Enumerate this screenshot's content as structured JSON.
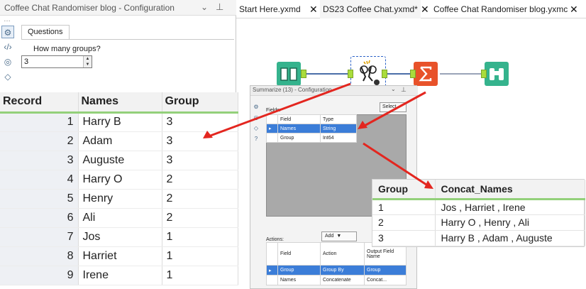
{
  "config_panel": {
    "title": "Coffee Chat Randomiser blog - Configuration",
    "tab": "Questions",
    "question": "How many groups?",
    "groups_value": "3"
  },
  "tabs": [
    {
      "label": "Start Here.yxmd"
    },
    {
      "label": "DS23 Coffee Chat.yxmd*"
    },
    {
      "label": "Coffee Chat Randomiser blog.yxmc"
    }
  ],
  "summarize": {
    "title": "Summarize (13) - Configuration",
    "fields_label": "Fields:",
    "select_label": "Select",
    "fields_header": [
      "Field",
      "Type"
    ],
    "fields": [
      {
        "field": "Names",
        "type": "String"
      },
      {
        "field": "Group",
        "type": "Int64"
      }
    ],
    "actions_label": "Actions:",
    "add_label": "Add",
    "actions_header": [
      "Field",
      "Action",
      "Output Field Name"
    ],
    "actions": [
      {
        "field": "Group",
        "action": "Group By",
        "output": "Group"
      },
      {
        "field": "Names",
        "action": "Concatenate",
        "output": "Concat..."
      }
    ]
  },
  "records": {
    "headers": [
      "Record",
      "Names",
      "Group"
    ],
    "rows": [
      {
        "record": "1",
        "name": "Harry B",
        "group": "3"
      },
      {
        "record": "2",
        "name": "Adam",
        "group": "3"
      },
      {
        "record": "3",
        "name": "Auguste",
        "group": "3"
      },
      {
        "record": "4",
        "name": "Harry O",
        "group": "2"
      },
      {
        "record": "5",
        "name": "Henry",
        "group": "2"
      },
      {
        "record": "6",
        "name": "Ali",
        "group": "2"
      },
      {
        "record": "7",
        "name": "Jos",
        "group": "1"
      },
      {
        "record": "8",
        "name": "Harriet",
        "group": "1"
      },
      {
        "record": "9",
        "name": "Irene",
        "group": "1"
      }
    ]
  },
  "result": {
    "headers": [
      "Group",
      "Concat_Names"
    ],
    "rows": [
      {
        "group": "1",
        "names": "Jos , Harriet , Irene"
      },
      {
        "group": "2",
        "names": "Harry O , Henry , Ali"
      },
      {
        "group": "3",
        "names": "Harry B , Adam , Auguste"
      }
    ]
  },
  "colors": {
    "arrow": "#e3261f",
    "accent_green": "#93d07a",
    "selection_blue": "#3b7dd8"
  }
}
